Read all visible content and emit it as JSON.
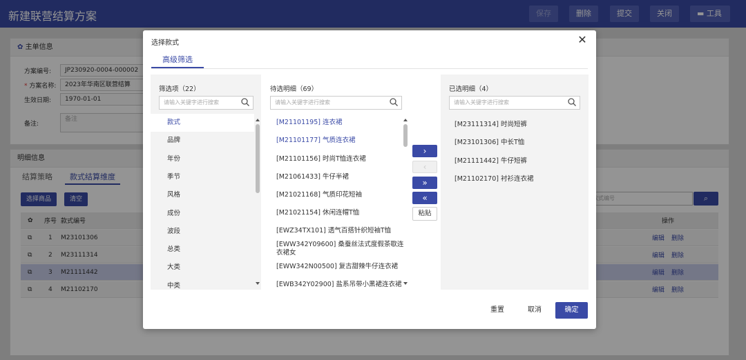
{
  "page": {
    "title": "新建联营结算方案",
    "toolbar": {
      "save": "保存",
      "delete": "删除",
      "submit": "提交",
      "close": "关闭",
      "tools": "工具"
    },
    "main_info": {
      "header": "主单信息",
      "plan_no_label": "方案编号:",
      "plan_no": "JP230920-0004-000002",
      "plan_name_label": "方案名称:",
      "plan_name": "2023年华南区联营结算",
      "effective_date_label": "生效日期:",
      "effective_date": "1970-01-01",
      "remark_label": "备注:",
      "remark_placeholder": "备注"
    },
    "detail": {
      "header": "明细信息",
      "tabs": [
        "结算策略",
        "款式结算维度"
      ],
      "select_goods": "选择商品",
      "clear": "清空",
      "search_placeholder": "款式编号",
      "table_head": {
        "seq": "序号",
        "style_code": "款式编号",
        "actions": "操作"
      },
      "rows": [
        {
          "seq": "1",
          "code": "M23101306",
          "edit": "编辑",
          "delete": "删除"
        },
        {
          "seq": "2",
          "code": "M23111314",
          "edit": "编辑",
          "delete": "删除"
        },
        {
          "seq": "3",
          "code": "M21111442",
          "edit": "编辑",
          "delete": "删除"
        },
        {
          "seq": "4",
          "code": "M21102170",
          "edit": "编辑",
          "delete": "删除"
        }
      ]
    }
  },
  "modal": {
    "title": "选择款式",
    "tab": "高级筛选",
    "filter_panel": {
      "title": "筛选项（22）",
      "search_placeholder": "请输入关键字进行搜索",
      "items": [
        "款式",
        "品牌",
        "年份",
        "季节",
        "风格",
        "成份",
        "波段",
        "总类",
        "大类",
        "中类"
      ],
      "active_index": 0
    },
    "pending_panel": {
      "title": "待选明细（69）",
      "search_placeholder": "请输入关键字进行搜索",
      "items": [
        {
          "text": "[M21101195] 连衣裙",
          "selected": true
        },
        {
          "text": "[M21101177] 气质连衣裙",
          "selected": true
        },
        {
          "text": "[M21101156] 时尚T恤连衣裙",
          "selected": false
        },
        {
          "text": "[M21061433] 牛仔半裙",
          "selected": false
        },
        {
          "text": "[M21021168] 气质印花短袖",
          "selected": false
        },
        {
          "text": "[M21021154] 休闲连帽T恤",
          "selected": false
        },
        {
          "text": "[EWZ34TX101] 透气百搭针织短袖T恤",
          "selected": false
        },
        {
          "text": "[EWW342Y09600] 桑蚕丝法式度假茶歇连衣裙女",
          "selected": false
        },
        {
          "text": "[EWW342N00500] 复古甜辣牛仔连衣裙",
          "selected": false
        },
        {
          "text": "[EWB342Y02900] 盐系吊带小黑裙连衣裙",
          "selected": false
        }
      ]
    },
    "transfer_buttons": {
      "add": "›",
      "remove": "‹",
      "add_all": "»",
      "remove_all": "«",
      "paste": "粘贴"
    },
    "selected_panel": {
      "title": "已选明细（4）",
      "search_placeholder": "请输入关键字进行搜索",
      "items": [
        "[M23111314] 时尚短裤",
        "[M23101306] 中长T恤",
        "[M21111442] 牛仔短裤",
        "[M21102170] 衬衫连衣裙"
      ]
    },
    "footer": {
      "reset": "重置",
      "cancel": "取消",
      "confirm": "确定"
    }
  }
}
